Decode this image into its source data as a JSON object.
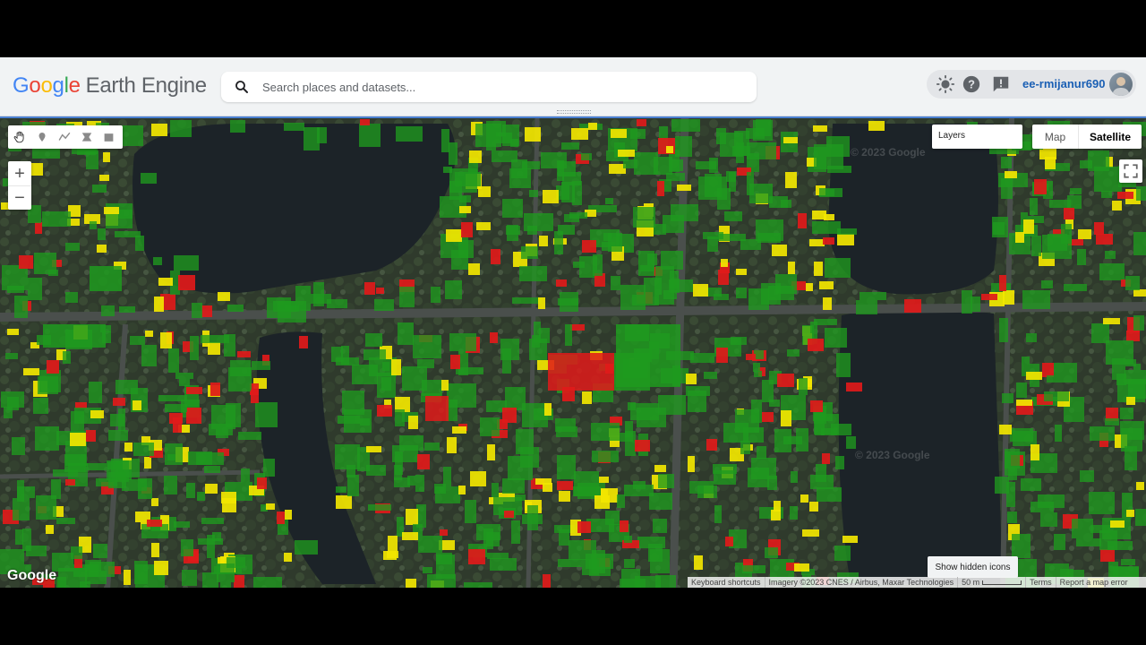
{
  "app": {
    "logo_letters": [
      "G",
      "o",
      "o",
      "g",
      "l",
      "e"
    ],
    "product": "Earth Engine"
  },
  "search": {
    "placeholder": "Search places and datasets..."
  },
  "header": {
    "icons": [
      "theme-toggle-icon",
      "help-icon",
      "feedback-icon"
    ],
    "project": "ee-rmijanur690"
  },
  "map": {
    "layers_label": "Layers",
    "map_type": {
      "map": "Map",
      "satellite": "Satellite",
      "selected": "Satellite"
    },
    "zoom_in": "+",
    "zoom_out": "−",
    "draw_tools": [
      "hand-pan-icon",
      "marker-pin-icon",
      "polyline-icon",
      "polygon-icon",
      "rectangle-icon"
    ],
    "google_mark": "Google",
    "watermark": "© 2023 Google",
    "show_hidden_icons": "Show hidden icons",
    "attribution": {
      "shortcuts": "Keyboard shortcuts",
      "imagery": "Imagery ©2023 CNES / Airbus, Maxar Technologies",
      "scale": "50 m",
      "terms": "Terms",
      "report": "Report a map error"
    },
    "legend_colors": {
      "green": "#1f9a1f",
      "yellow": "#f2e600",
      "red": "#e01a1a"
    }
  }
}
